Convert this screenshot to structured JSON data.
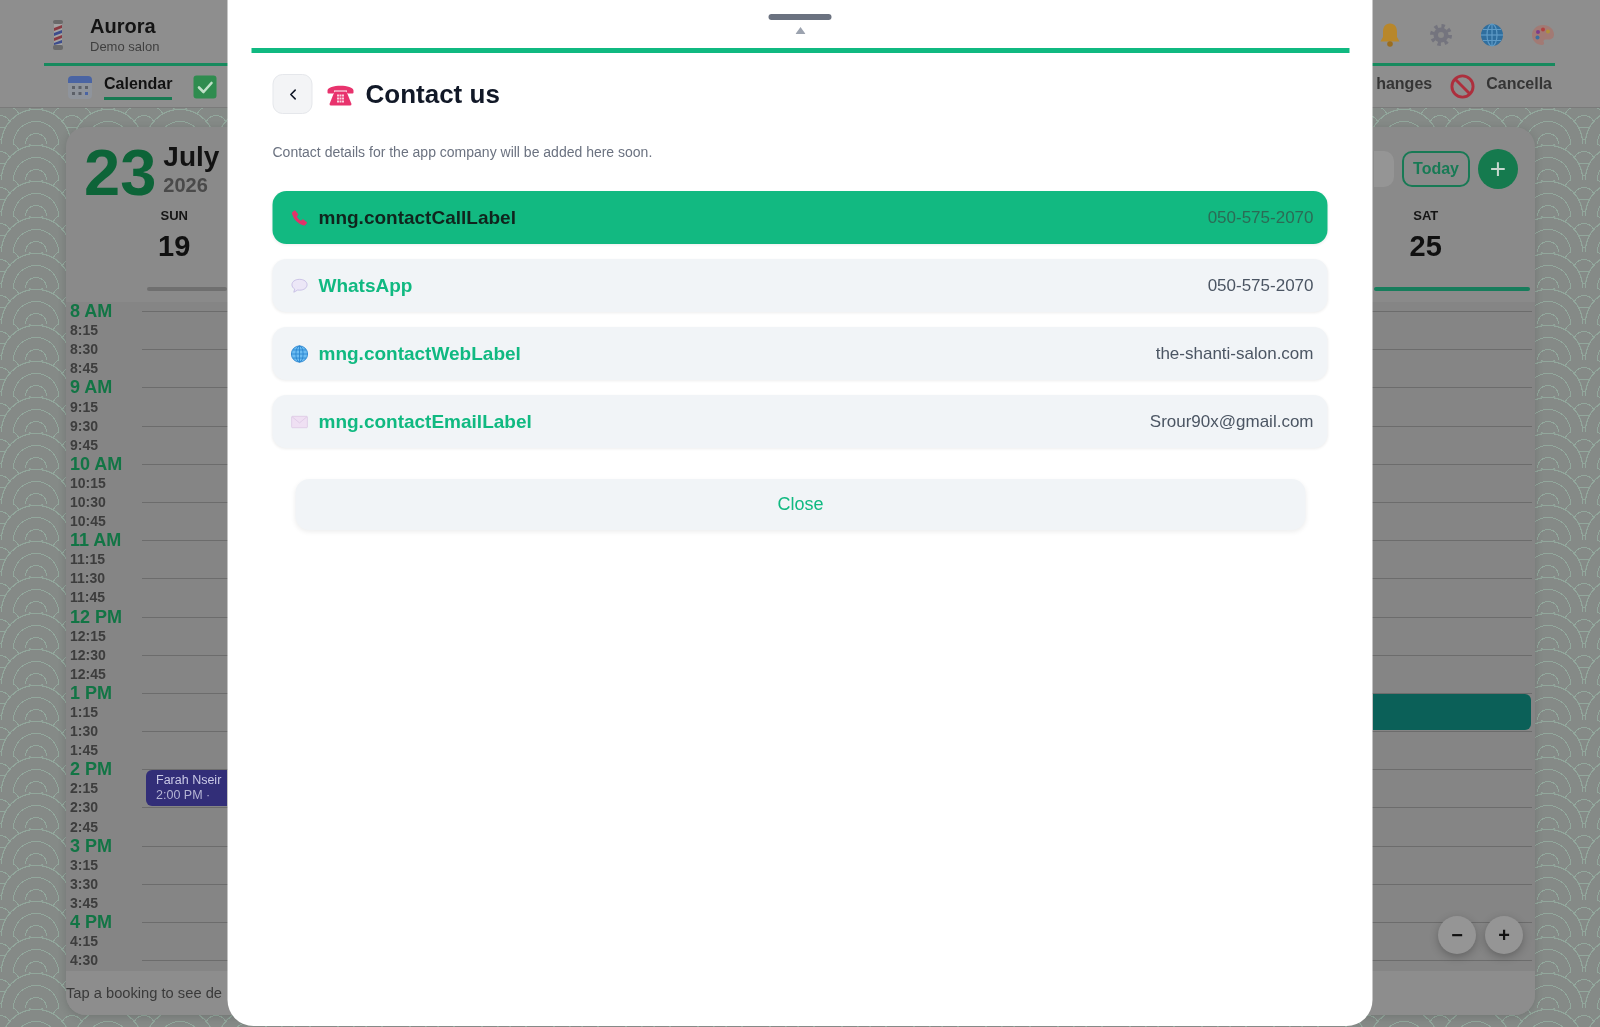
{
  "header": {
    "brand": {
      "name": "Aurora",
      "subtitle": "Demo salon"
    },
    "nav_start": [
      {
        "label": "Calendar",
        "selected": true
      }
    ],
    "nav_end": [
      {
        "label": "hanges",
        "selected": false
      },
      {
        "label": "Cancella",
        "selected": false
      }
    ]
  },
  "calendar": {
    "day": "23",
    "month": "July",
    "year": "2026",
    "today_button": "Today",
    "add_button": "+",
    "days": [
      {
        "weekday": "SUN",
        "date": "19",
        "selected": false
      },
      {
        "weekday": "SAT",
        "date": "25",
        "selected": true
      }
    ],
    "times": [
      {
        "label": "8 AM",
        "kind": "hour"
      },
      {
        "label": "8:15",
        "kind": "quarter"
      },
      {
        "label": "8:30",
        "kind": "quarter"
      },
      {
        "label": "8:45",
        "kind": "quarter"
      },
      {
        "label": "9 AM",
        "kind": "hour"
      },
      {
        "label": "9:15",
        "kind": "quarter"
      },
      {
        "label": "9:30",
        "kind": "quarter"
      },
      {
        "label": "9:45",
        "kind": "quarter"
      },
      {
        "label": "10 AM",
        "kind": "hour"
      },
      {
        "label": "10:15",
        "kind": "quarter"
      },
      {
        "label": "10:30",
        "kind": "quarter"
      },
      {
        "label": "10:45",
        "kind": "quarter"
      },
      {
        "label": "11 AM",
        "kind": "hour"
      },
      {
        "label": "11:15",
        "kind": "quarter"
      },
      {
        "label": "11:30",
        "kind": "quarter"
      },
      {
        "label": "11:45",
        "kind": "quarter"
      },
      {
        "label": "12 PM",
        "kind": "hour"
      },
      {
        "label": "12:15",
        "kind": "quarter"
      },
      {
        "label": "12:30",
        "kind": "quarter"
      },
      {
        "label": "12:45",
        "kind": "quarter"
      },
      {
        "label": "1 PM",
        "kind": "hour"
      },
      {
        "label": "1:15",
        "kind": "quarter"
      },
      {
        "label": "1:30",
        "kind": "quarter"
      },
      {
        "label": "1:45",
        "kind": "quarter"
      },
      {
        "label": "2 PM",
        "kind": "hour"
      },
      {
        "label": "2:15",
        "kind": "quarter"
      },
      {
        "label": "2:30",
        "kind": "quarter"
      },
      {
        "label": "2:45",
        "kind": "quarter"
      },
      {
        "label": "3 PM",
        "kind": "hour"
      },
      {
        "label": "3:15",
        "kind": "quarter"
      },
      {
        "label": "3:30",
        "kind": "quarter"
      },
      {
        "label": "3:45",
        "kind": "quarter"
      },
      {
        "label": "4 PM",
        "kind": "hour"
      },
      {
        "label": "4:15",
        "kind": "quarter"
      },
      {
        "label": "4:30",
        "kind": "quarter"
      }
    ],
    "bookings": [
      {
        "name": "Farah Nseir",
        "time": "2:00 PM ·",
        "color": "#322e78"
      },
      {
        "color": "#0b6058"
      }
    ],
    "zoom_buttons": [
      "−",
      "+"
    ],
    "hint": "Tap a booking to see de"
  },
  "dialog": {
    "title": "Contact us",
    "description": "Contact details for the app company will be added here soon.",
    "contacts": [
      {
        "kind": "phone",
        "label": "mng.contactCallLabel",
        "value": "050-575-2070",
        "selected": true
      },
      {
        "kind": "chat",
        "label": "WhatsApp",
        "value": "050-575-2070",
        "selected": false
      },
      {
        "kind": "web",
        "label": "mng.contactWebLabel",
        "value": "the-shanti-salon.com",
        "selected": false
      },
      {
        "kind": "email",
        "label": "mng.contactEmailLabel",
        "value": "Srour90x@gmail.com",
        "selected": false
      }
    ],
    "close_button": "Close"
  }
}
